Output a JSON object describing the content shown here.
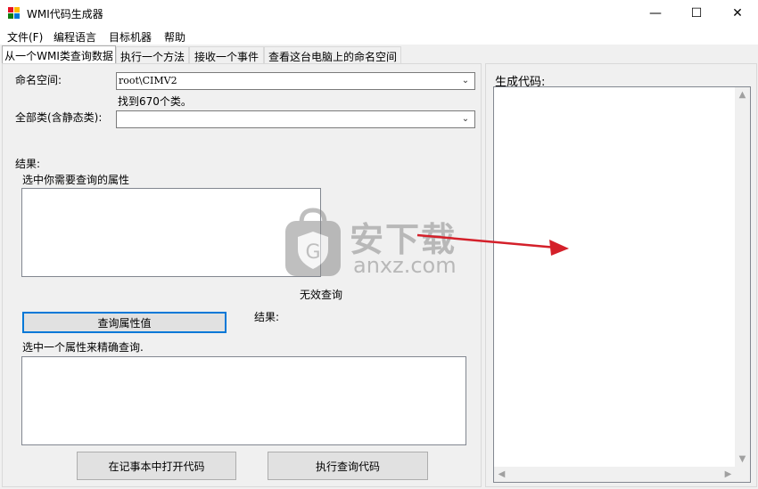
{
  "window": {
    "title": "WMI代码生成器",
    "controls": {
      "minimize": "—",
      "maximize": "☐",
      "close": "✕"
    }
  },
  "menu": [
    {
      "label": "文件(F)"
    },
    {
      "label": "编程语言"
    },
    {
      "label": "目标机器"
    },
    {
      "label": "帮助"
    }
  ],
  "tabs": [
    {
      "label": "从一个WMI类查询数据",
      "active": true
    },
    {
      "label": "执行一个方法",
      "active": false
    },
    {
      "label": "接收一个事件",
      "active": false
    },
    {
      "label": "查看这台电脑上的命名空间",
      "active": false
    }
  ],
  "query": {
    "namespace_label": "命名空间:",
    "namespace_value": "root\\CIMV2",
    "found_text": "找到670个类。",
    "classes_label": "全部类(含静态类):",
    "classes_value": "",
    "results_label": "结果:",
    "select_props_label": "选中你需要查询的属性",
    "invalid_query_text": "无效查询",
    "query_values_button": "查询属性值",
    "results_label_2": "结果:",
    "select_one_label": "选中一个属性来精确查询.",
    "open_notepad_button": "在记事本中打开代码",
    "execute_button": "执行查询代码"
  },
  "code_panel": {
    "label": "生成代码:"
  },
  "watermark": {
    "text": "安下载",
    "sub": "anxz.com"
  },
  "colors": {
    "accent": "#0078d7",
    "arrow": "#d4202a",
    "window_bg": "#f0f0f0"
  }
}
